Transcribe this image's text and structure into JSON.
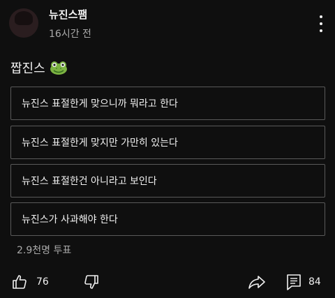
{
  "post": {
    "channel_name": "뉴진스팸",
    "timestamp": "16시간 전",
    "text": "짭진스",
    "emoji_icon": "frog-face-icon"
  },
  "poll": {
    "options": [
      "뉴진스 표절한게 맞으니까 뭐라고 한다",
      "뉴진스 표절한게 맞지만 가만히 있는다",
      "뉴진스 표절한건 아니라고 보인다",
      "뉴진스가 사과해야 한다"
    ],
    "votes": "2.9천명 투표"
  },
  "actions": {
    "like_count": "76",
    "comment_count": "84",
    "like_icon": "thumbs-up-icon",
    "dislike_icon": "thumbs-down-icon",
    "share_icon": "share-icon",
    "comment_icon": "comment-icon",
    "more_icon": "more-vertical-icon"
  },
  "colors": {
    "background": "#0f0f0f",
    "text": "#f1f1f1",
    "muted": "#aaaaaa",
    "frog_green": "#7cb342"
  }
}
